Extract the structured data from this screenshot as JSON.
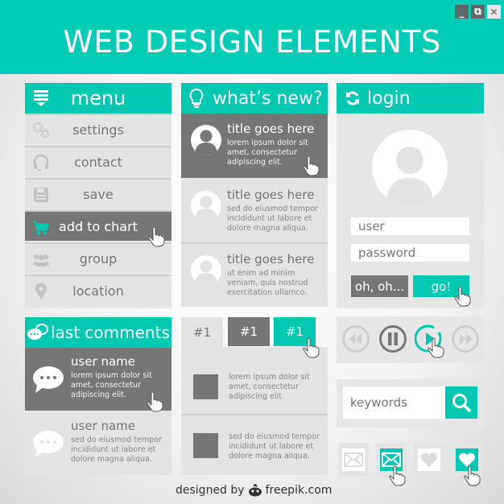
{
  "window": {
    "title": "WEB DESIGN ELEMENTS",
    "controls": {
      "minimize": "_",
      "restore": "⧉",
      "close": "✕"
    }
  },
  "colors": {
    "accent": "#00c9b0",
    "active": "#767676",
    "panel": "#e3e3e3",
    "text": "#777777"
  },
  "menu": {
    "title": "menu",
    "items": [
      {
        "label": "settings",
        "icon": "gears-icon"
      },
      {
        "label": "contact",
        "icon": "headset-icon"
      },
      {
        "label": "save",
        "icon": "floppy-icon"
      },
      {
        "label": "add to chart",
        "icon": "cart-icon",
        "active": true
      },
      {
        "label": "group",
        "icon": "group-icon"
      },
      {
        "label": "location",
        "icon": "location-pin-icon"
      }
    ]
  },
  "news": {
    "title": "what’s new?",
    "items": [
      {
        "title": "title goes here",
        "text": "lorem ipsum dolor sit amet, consectetur adipiscing elit.",
        "active": true
      },
      {
        "title": "title goes here",
        "text": "sed do eiusmod tempor incididunt ut labore et dolore magna aliqua."
      },
      {
        "title": "title goes here",
        "text": "ut enim ad minim veniam, quis nostrud exercitation ullamco."
      }
    ]
  },
  "login": {
    "title": "login",
    "user_placeholder": "user",
    "password_placeholder": "password",
    "cancel_label": "oh, oh...",
    "submit_label": "go!"
  },
  "comments": {
    "title": "last comments",
    "items": [
      {
        "user": "user name",
        "text": "lorem ipsum dolor sit amet, consectetur adipiscing elit.",
        "active": true
      },
      {
        "user": "user name",
        "text": "sed do eiusmod tempor incididunt ut labore et dolore magna aliqua."
      }
    ]
  },
  "tabs": {
    "labels": [
      "#1",
      "#1",
      "#1"
    ],
    "items": [
      {
        "text": "lorem ipsum dolor sit amet, consectetur adipiscing elit."
      },
      {
        "text": "sed do eiusmod tempor incididunt ut labore et dolore magna aliqua."
      }
    ]
  },
  "media": {
    "buttons": [
      "rewind",
      "pause",
      "play",
      "fast-forward"
    ],
    "active": "play"
  },
  "search": {
    "placeholder": "keywords"
  },
  "icon_buttons": [
    "mail",
    "mail-active",
    "heart",
    "heart-active"
  ],
  "credit": {
    "prefix": "designed by",
    "brand": "freepik.com"
  }
}
